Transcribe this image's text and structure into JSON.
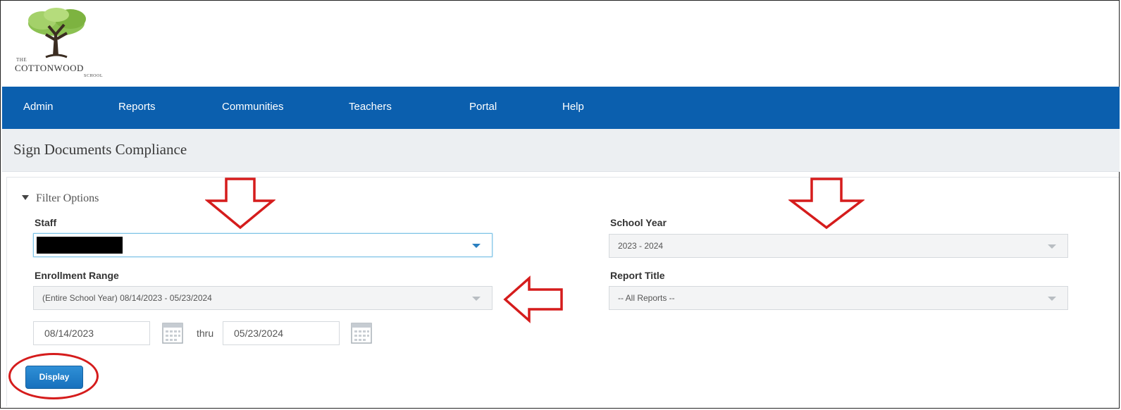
{
  "logo": {
    "the": "THE",
    "name": "COTTONWOOD",
    "school": "SCHOOL"
  },
  "nav": {
    "items": [
      "Admin",
      "Reports",
      "Communities",
      "Teachers",
      "Portal",
      "Help"
    ]
  },
  "page": {
    "title": "Sign Documents Compliance"
  },
  "filters": {
    "toggle_label": "Filter Options",
    "staff": {
      "label": "Staff",
      "value": ""
    },
    "school_year": {
      "label": "School Year",
      "value": "2023 - 2024"
    },
    "enrollment_range": {
      "label": "Enrollment Range",
      "value": "(Entire School Year) 08/14/2023 - 05/23/2024"
    },
    "report_title": {
      "label": "Report Title",
      "value": "-- All Reports --"
    },
    "start_date": "08/14/2023",
    "thru_label": "thru",
    "end_date": "05/23/2024"
  },
  "actions": {
    "display_label": "Display"
  },
  "colors": {
    "nav_bg": "#0b5fae",
    "annotation_red": "#d51c1c",
    "button_blue": "#1f7fcb"
  }
}
